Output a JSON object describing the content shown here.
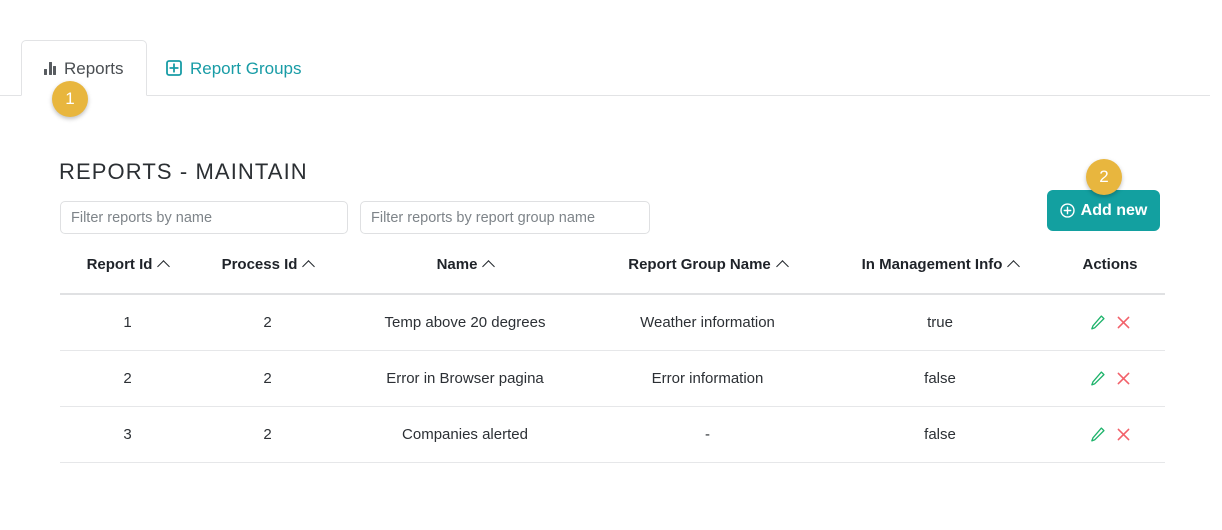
{
  "tabs": [
    {
      "label": "Reports",
      "icon": "bar-chart-icon",
      "active": true
    },
    {
      "label": "Report Groups",
      "icon": "plus-box-icon",
      "active": false
    }
  ],
  "badges": [
    {
      "number": "1"
    },
    {
      "number": "2"
    }
  ],
  "page": {
    "title": "REPORTS - MAINTAIN"
  },
  "filters": {
    "name_placeholder": "Filter reports by name",
    "name_value": "",
    "group_placeholder": "Filter reports by report group name",
    "group_value": ""
  },
  "toolbar": {
    "add_new_label": "Add new",
    "add_new_icon": "plus-circle-icon"
  },
  "table": {
    "columns": [
      {
        "label": "Report Id",
        "sortable": true
      },
      {
        "label": "Process Id",
        "sortable": true
      },
      {
        "label": "Name",
        "sortable": true
      },
      {
        "label": "Report Group Name",
        "sortable": true
      },
      {
        "label": "In Management Info",
        "sortable": true
      },
      {
        "label": "Actions",
        "sortable": false
      }
    ],
    "rows": [
      {
        "report_id": "1",
        "process_id": "2",
        "name": "Temp above 20 degrees",
        "report_group_name": "Weather information",
        "in_management_info": "true"
      },
      {
        "report_id": "2",
        "process_id": "2",
        "name": "Error in Browser pagina",
        "report_group_name": "Error information",
        "in_management_info": "false"
      },
      {
        "report_id": "3",
        "process_id": "2",
        "name": "Companies alerted",
        "report_group_name": "-",
        "in_management_info": "false"
      }
    ],
    "row_actions": [
      {
        "icon": "edit-pencil-icon"
      },
      {
        "icon": "delete-x-icon"
      }
    ]
  },
  "colors": {
    "accent_teal": "#13a0a0",
    "badge_amber": "#e8b63e",
    "edit_green": "#1eb36b",
    "delete_red": "#f2616a",
    "border_gray": "#e2e3e5"
  }
}
